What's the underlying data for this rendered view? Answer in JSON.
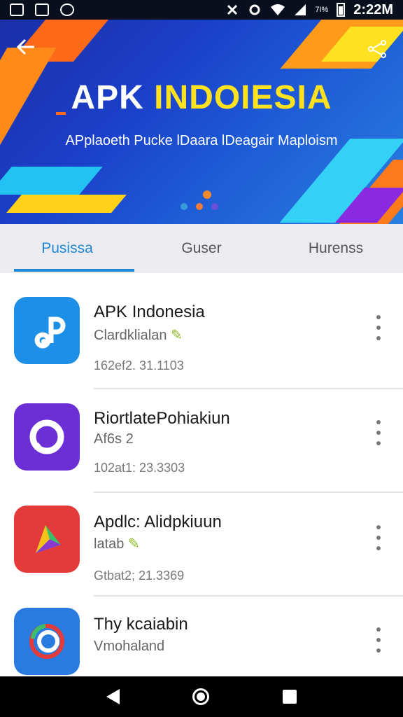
{
  "status_bar": {
    "time": "2:22M",
    "small_text": "7I%"
  },
  "banner": {
    "back_icon": "arrow-left-icon",
    "share_icon": "share-icon",
    "title_part1": "APK ",
    "title_part2": "INDOIESIA",
    "subtitle": "APplaoeth Pucke lDaara lDeagair Maploism"
  },
  "tabs": [
    {
      "label": "Pusissa",
      "active": true
    },
    {
      "label": "Guser",
      "active": false
    },
    {
      "label": "Hurenss",
      "active": false
    }
  ],
  "apps": [
    {
      "name": "APK Indonesia",
      "category": "Clardklialan",
      "meta": "162ef2. 31.1103",
      "icon": "app-blue-icon",
      "color": "#1e8fe6"
    },
    {
      "name": "RiortlatePohiakiun",
      "category": "Af6s 2",
      "meta": "102at1: 23.3303",
      "icon": "app-purple-icon",
      "color": "#6c2fd6"
    },
    {
      "name": "Apdlc: Alidpkiuun",
      "category": "latab",
      "meta": "Gtbat2; 21.3369",
      "icon": "play-icon",
      "color": "#e53a3a"
    },
    {
      "name": "Thy kcaiabin",
      "category": "Vmohaland",
      "meta": "",
      "icon": "app-ring-icon",
      "color": "#2a7be0"
    }
  ],
  "navbar": {
    "back": "nav-back-icon",
    "home": "nav-home-icon",
    "recent": "nav-recent-icon"
  }
}
